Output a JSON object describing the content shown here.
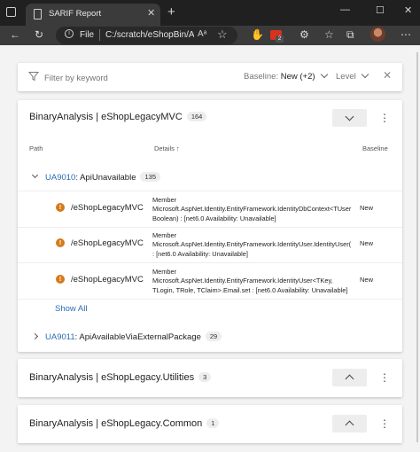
{
  "browser": {
    "tab_title": "SARIF Report",
    "tab_close": "✕",
    "new_tab": "+",
    "minimize": "—",
    "maximize": "☐",
    "close": "✕",
    "address": {
      "file_label": "File",
      "url": "C:/scratch/eShopBin/A...",
      "read_aloud": "Aᵃ"
    },
    "extension_badge": "2"
  },
  "filter": {
    "placeholder": "Filter by keyword",
    "baseline_label": "Baseline: ",
    "baseline_value": "New (+2)",
    "level_label": "Level",
    "clear": "✕"
  },
  "runs": [
    {
      "title": "BinaryAnalysis | eShopLegacyMVC",
      "count": "164",
      "columns": {
        "path": "Path",
        "details": "Details",
        "details_sort": "↑",
        "baseline": "Baseline"
      },
      "groups": [
        {
          "rule_id": "UA9010",
          "rule_message": ": ApiUnavailable",
          "count": "135",
          "results": [
            {
              "icon": "!",
              "path": "/eShopLegacyMVC",
              "details": [
                "Member",
                "Microsoft.AspNet.Identity.EntityFramework.IdentityDbContext<TUser",
                "Boolean) : [net6.0 Availability: Unavailable]"
              ],
              "baseline": "New"
            },
            {
              "icon": "!",
              "path": "/eShopLegacyMVC",
              "details": [
                "Member",
                "Microsoft.AspNet.Identity.EntityFramework.IdentityUser.IdentityUser(",
                ": [net6.0 Availability: Unavailable]"
              ],
              "baseline": "New"
            },
            {
              "icon": "!",
              "path": "/eShopLegacyMVC",
              "details": [
                "Member",
                "Microsoft.AspNet.Identity.EntityFramework.IdentityUser<TKey,",
                "TLogin, TRole, TClaim>.Email.set : [net6.0 Availability: Unavailable]"
              ],
              "baseline": "New"
            }
          ],
          "show_all": "Show All"
        },
        {
          "rule_id": "UA9011",
          "rule_message": ": ApiAvailableViaExternalPackage",
          "count": "29"
        }
      ]
    },
    {
      "title": "BinaryAnalysis | eShopLegacy.Utilities",
      "count": "3"
    },
    {
      "title": "BinaryAnalysis | eShopLegacy.Common",
      "count": "1"
    }
  ],
  "kebab": "⋮"
}
